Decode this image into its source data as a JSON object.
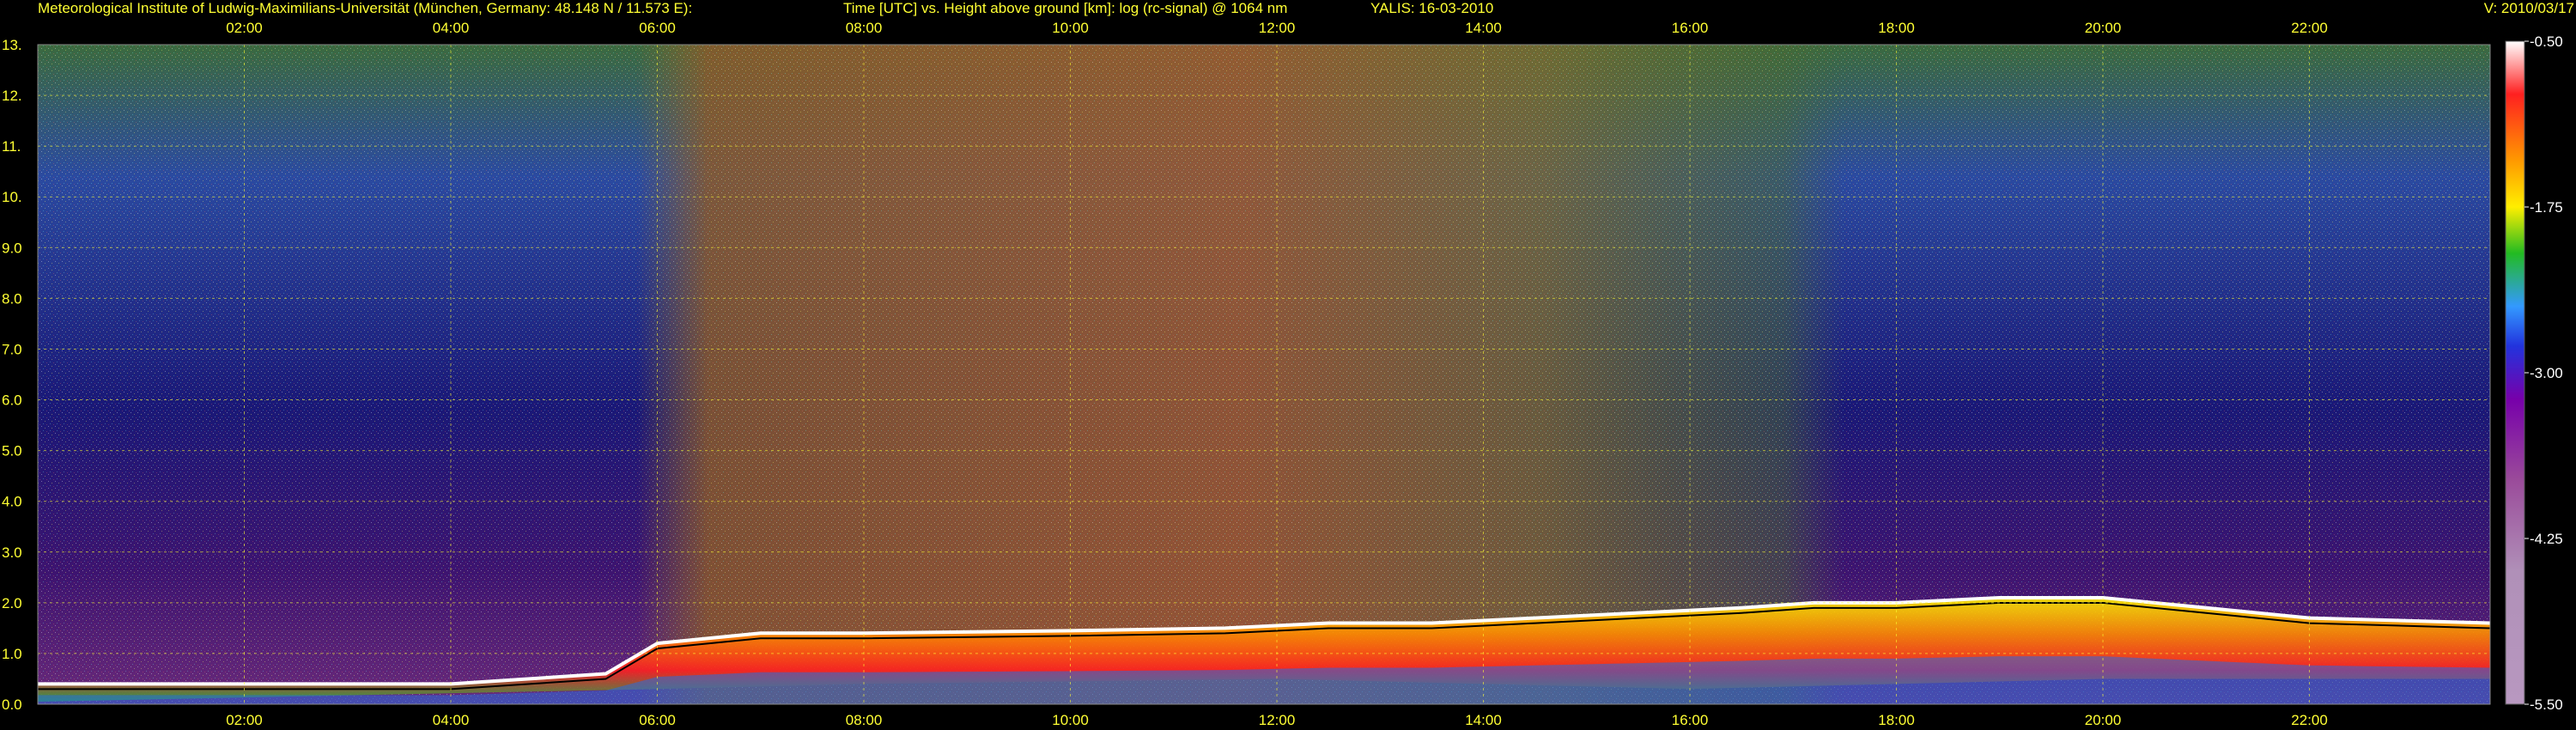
{
  "header": {
    "institute": "Meteorological Institute of Ludwig-Maximilians-Universität (München, Germany: 48.148 N / 11.573 E):",
    "plot_title": "Time [UTC] vs. Height above ground [km]: log (rc-signal) @ 1064 nm",
    "instrument_date": "YALIS: 16-03-2010",
    "version": "V: 2010/03/17"
  },
  "colors": {
    "background": "#000000",
    "text": "#ffff33",
    "grid": "#ffff33",
    "colorbar_label": "#ffffff"
  },
  "chart_data": {
    "type": "heatmap",
    "title": "Time [UTC] vs. Height above ground [km]: log (rc-signal) @ 1064 nm",
    "xlabel": "Time [UTC]",
    "ylabel": "Height above ground [km]",
    "x_hours_range": [
      0.0,
      23.75
    ],
    "ylim": [
      0.0,
      13.0
    ],
    "x_ticks": [
      "02:00",
      "04:00",
      "06:00",
      "08:00",
      "10:00",
      "12:00",
      "14:00",
      "16:00",
      "18:00",
      "20:00",
      "22:00"
    ],
    "x_tick_hours": [
      2,
      4,
      6,
      8,
      10,
      12,
      14,
      16,
      18,
      20,
      22
    ],
    "y_ticks": [
      "0.0",
      "1.0",
      "2.0",
      "3.0",
      "4.0",
      "5.0",
      "6.0",
      "7.0",
      "8.0",
      "9.0",
      "10.",
      "11.",
      "12.",
      "13."
    ],
    "y_tick_values": [
      0,
      1,
      2,
      3,
      4,
      5,
      6,
      7,
      8,
      9,
      10,
      11,
      12,
      13
    ],
    "grid": true,
    "colorbar": {
      "range": [
        -5.5,
        -0.5
      ],
      "ticks": [
        "-0.50",
        "-1.75",
        "-3.00",
        "-4.25",
        "-5.50"
      ],
      "tick_values": [
        -0.5,
        -1.75,
        -3.0,
        -4.25,
        -5.5
      ],
      "color_stops": [
        {
          "value": -0.5,
          "color": "#ffffff"
        },
        {
          "value": -0.9,
          "color": "#ff2020"
        },
        {
          "value": -1.4,
          "color": "#ff9900"
        },
        {
          "value": -1.75,
          "color": "#ffee00"
        },
        {
          "value": -2.1,
          "color": "#22bb22"
        },
        {
          "value": -2.5,
          "color": "#3399ff"
        },
        {
          "value": -2.8,
          "color": "#2233dd"
        },
        {
          "value": -3.2,
          "color": "#7700aa"
        },
        {
          "value": -3.8,
          "color": "#9a4a9a"
        },
        {
          "value": -4.5,
          "color": "#b090b8"
        },
        {
          "value": -5.5,
          "color": "#b898c0"
        }
      ]
    },
    "layers": [
      {
        "name": "boundary layer top height",
        "x_hours": [
          0,
          2,
          4,
          5.5,
          6,
          7,
          8,
          10,
          11.5,
          12.5,
          13.5,
          14.5,
          15.5,
          16.5,
          17.2,
          18,
          19,
          20,
          21,
          22,
          23.75
        ],
        "y_km": [
          0.4,
          0.4,
          0.4,
          0.6,
          1.2,
          1.4,
          1.4,
          1.45,
          1.5,
          1.6,
          1.6,
          1.7,
          1.8,
          1.9,
          2.0,
          2.0,
          2.1,
          2.1,
          1.9,
          1.7,
          1.6
        ]
      },
      {
        "name": "aerosol layer bottom height",
        "x_hours": [
          0,
          6,
          8,
          10,
          12,
          14,
          16,
          18,
          20,
          22,
          23.75
        ],
        "y_km": [
          0.05,
          0.3,
          0.4,
          0.45,
          0.5,
          0.4,
          0.3,
          0.4,
          0.5,
          0.5,
          0.5
        ]
      }
    ]
  }
}
